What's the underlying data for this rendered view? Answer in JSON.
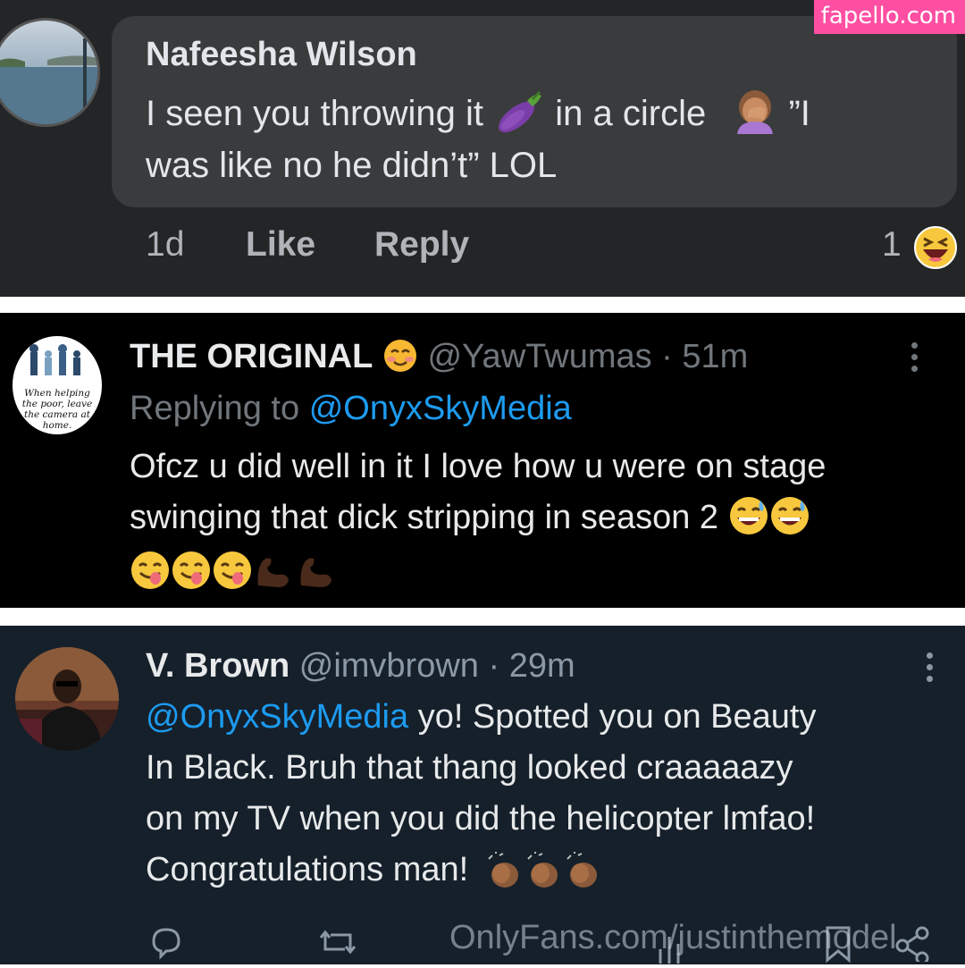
{
  "watermark": {
    "site": "fapello.com",
    "bottom": "OnlyFans.com/justinthemodel"
  },
  "fb_comment": {
    "author": "Nafeesha Wilson",
    "line1_a": "I seen you throwing it",
    "line1_b": "in a circle",
    "line1_c": "”I",
    "line2": "was like no he didn’t” LOL",
    "time": "1d",
    "like_label": "Like",
    "reply_label": "Reply",
    "reaction_count": "1",
    "emojis": [
      "eggplant-emoji",
      "facepalm-emoji",
      "laughing-emoji"
    ]
  },
  "tweet1": {
    "name": "THE ORIGINAL",
    "handle": "@YawTwumas",
    "sep": "·",
    "time": "51m",
    "replying_prefix": "Replying to",
    "replying_handle": "@OnyxSkyMedia",
    "text_line1": "Ofcz u did well in it I love how u were on stage",
    "text_line2": "swinging that dick stripping in season 2",
    "avatar_text": "When helping the poor, leave the camera at home.",
    "emojis": [
      "smiling-blush-emoji",
      "sweat-smile-emoji",
      "yum-emoji",
      "flexed-biceps-emoji"
    ]
  },
  "tweet2": {
    "name": "V. Brown",
    "handle": "@imvbrown",
    "sep": "·",
    "time": "29m",
    "mention": "@OnyxSkyMedia",
    "text_line1": "yo! Spotted you on Beauty",
    "text_line2": "In Black. Bruh that thang looked craaaaazy",
    "text_line3": "on my TV when you did the helicopter lmfao!",
    "text_line4": "Congratulations man!",
    "emojis": [
      "clapping-hands-emoji"
    ]
  },
  "colors": {
    "fb_bg": "#242526",
    "fb_bubble": "#3a3b3c",
    "twitter_blue": "#1d9bf0",
    "dim_bg": "#15202b",
    "pink": "#ff4fa3"
  }
}
